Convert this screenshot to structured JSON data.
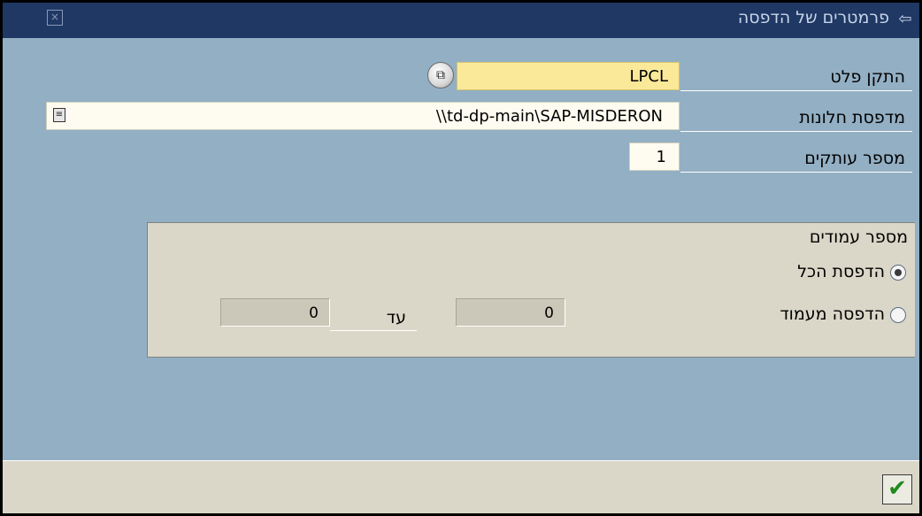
{
  "window": {
    "title": "פרמטרים של הדפסה",
    "title_icon": "print-params-icon",
    "close_icon": "close-icon"
  },
  "form": {
    "output_device": {
      "label": "התקן פלט",
      "value": "LPCL"
    },
    "windows_printer": {
      "label": "מדפסת חלונות",
      "value": "\\\\td-dp-main\\SAP-MISDERON"
    },
    "copies": {
      "label": "מספר עותקים",
      "value": "1"
    }
  },
  "pages_group": {
    "title": "מספר עמודים",
    "print_all_label": "הדפסת הכל",
    "print_from_label": "הדפסה מעמוד",
    "to_label": "עד",
    "from_value": "0",
    "to_value": "0",
    "selected": "print_all"
  },
  "footer": {
    "ok_icon": "checkmark-icon"
  },
  "colors": {
    "background": "#93afc4",
    "titlebar": "#1f3864",
    "panel": "#dad7c8",
    "required_field": "#fbe99a"
  }
}
